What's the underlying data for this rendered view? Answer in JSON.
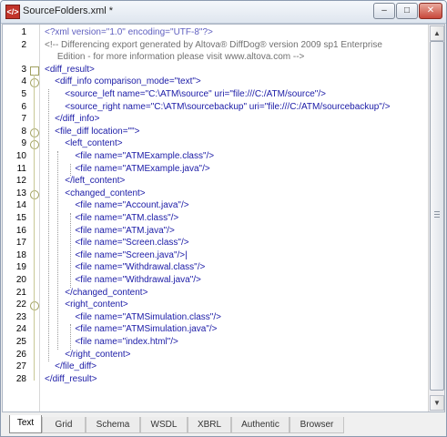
{
  "window": {
    "title": "SourceFolders.xml *",
    "app_icon": "xml-file-icon",
    "controls": [
      "minimize-icon",
      "maximize-icon",
      "close-icon"
    ]
  },
  "editor": {
    "lines": [
      {
        "n": "1",
        "fold": "",
        "text": "<?xml version=\"1.0\" encoding=\"UTF-8\"?>"
      },
      {
        "n": "2",
        "fold": "",
        "text": "<!-- Differencing export generated by Altova® DiffDog® version 2009 sp1 Enterprise"
      },
      {
        "n": "",
        "fold": "",
        "text": "     Edition - for more information please visit www.altova.com -->"
      },
      {
        "n": "3",
        "fold": "box",
        "text": "<diff_result>"
      },
      {
        "n": "4",
        "fold": "circle",
        "text": "    <diff_info comparison_mode=\"text\">"
      },
      {
        "n": "5",
        "fold": "",
        "text": "        <source_left name=\"C:\\ATM\\source\" uri=\"file:///C:/ATM/source\"/>"
      },
      {
        "n": "6",
        "fold": "",
        "text": "        <source_right name=\"C:\\ATM\\sourcebackup\" uri=\"file:///C:/ATM/sourcebackup\"/>"
      },
      {
        "n": "7",
        "fold": "",
        "text": "    </diff_info>"
      },
      {
        "n": "8",
        "fold": "circle",
        "text": "    <file_diff location=\"\">"
      },
      {
        "n": "9",
        "fold": "circle",
        "text": "        <left_content>"
      },
      {
        "n": "10",
        "fold": "",
        "text": "            <file name=\"ATMExample.class\"/>"
      },
      {
        "n": "11",
        "fold": "",
        "text": "            <file name=\"ATMExample.java\"/>"
      },
      {
        "n": "12",
        "fold": "",
        "text": "        </left_content>"
      },
      {
        "n": "13",
        "fold": "circle",
        "text": "        <changed_content>"
      },
      {
        "n": "14",
        "fold": "",
        "text": "            <file name=\"Account.java\"/>"
      },
      {
        "n": "15",
        "fold": "",
        "text": "            <file name=\"ATM.class\"/>"
      },
      {
        "n": "16",
        "fold": "",
        "text": "            <file name=\"ATM.java\"/>"
      },
      {
        "n": "17",
        "fold": "",
        "text": "            <file name=\"Screen.class\"/>"
      },
      {
        "n": "18",
        "fold": "",
        "text": "            <file name=\"Screen.java\"/>|"
      },
      {
        "n": "19",
        "fold": "",
        "text": "            <file name=\"Withdrawal.class\"/>"
      },
      {
        "n": "20",
        "fold": "",
        "text": "            <file name=\"Withdrawal.java\"/>"
      },
      {
        "n": "21",
        "fold": "",
        "text": "        </changed_content>"
      },
      {
        "n": "22",
        "fold": "circle",
        "text": "        <right_content>"
      },
      {
        "n": "23",
        "fold": "",
        "text": "            <file name=\"ATMSimulation.class\"/>"
      },
      {
        "n": "24",
        "fold": "",
        "text": "            <file name=\"ATMSimulation.java\"/>"
      },
      {
        "n": "25",
        "fold": "",
        "text": "            <file name=\"index.html\"/>"
      },
      {
        "n": "26",
        "fold": "",
        "text": "        </right_content>"
      },
      {
        "n": "27",
        "fold": "",
        "text": "    </file_diff>"
      },
      {
        "n": "28",
        "fold": "",
        "text": "</diff_result>"
      }
    ]
  },
  "scrollbar": {
    "up_icon": "arrow-up-icon",
    "down_icon": "arrow-down-icon"
  },
  "tabs": [
    {
      "label": "Text",
      "active": true
    },
    {
      "label": "Grid",
      "active": false
    },
    {
      "label": "Schema",
      "active": false
    },
    {
      "label": "WSDL",
      "active": false
    },
    {
      "label": "XBRL",
      "active": false
    },
    {
      "label": "Authentic",
      "active": false
    },
    {
      "label": "Browser",
      "active": false
    }
  ]
}
